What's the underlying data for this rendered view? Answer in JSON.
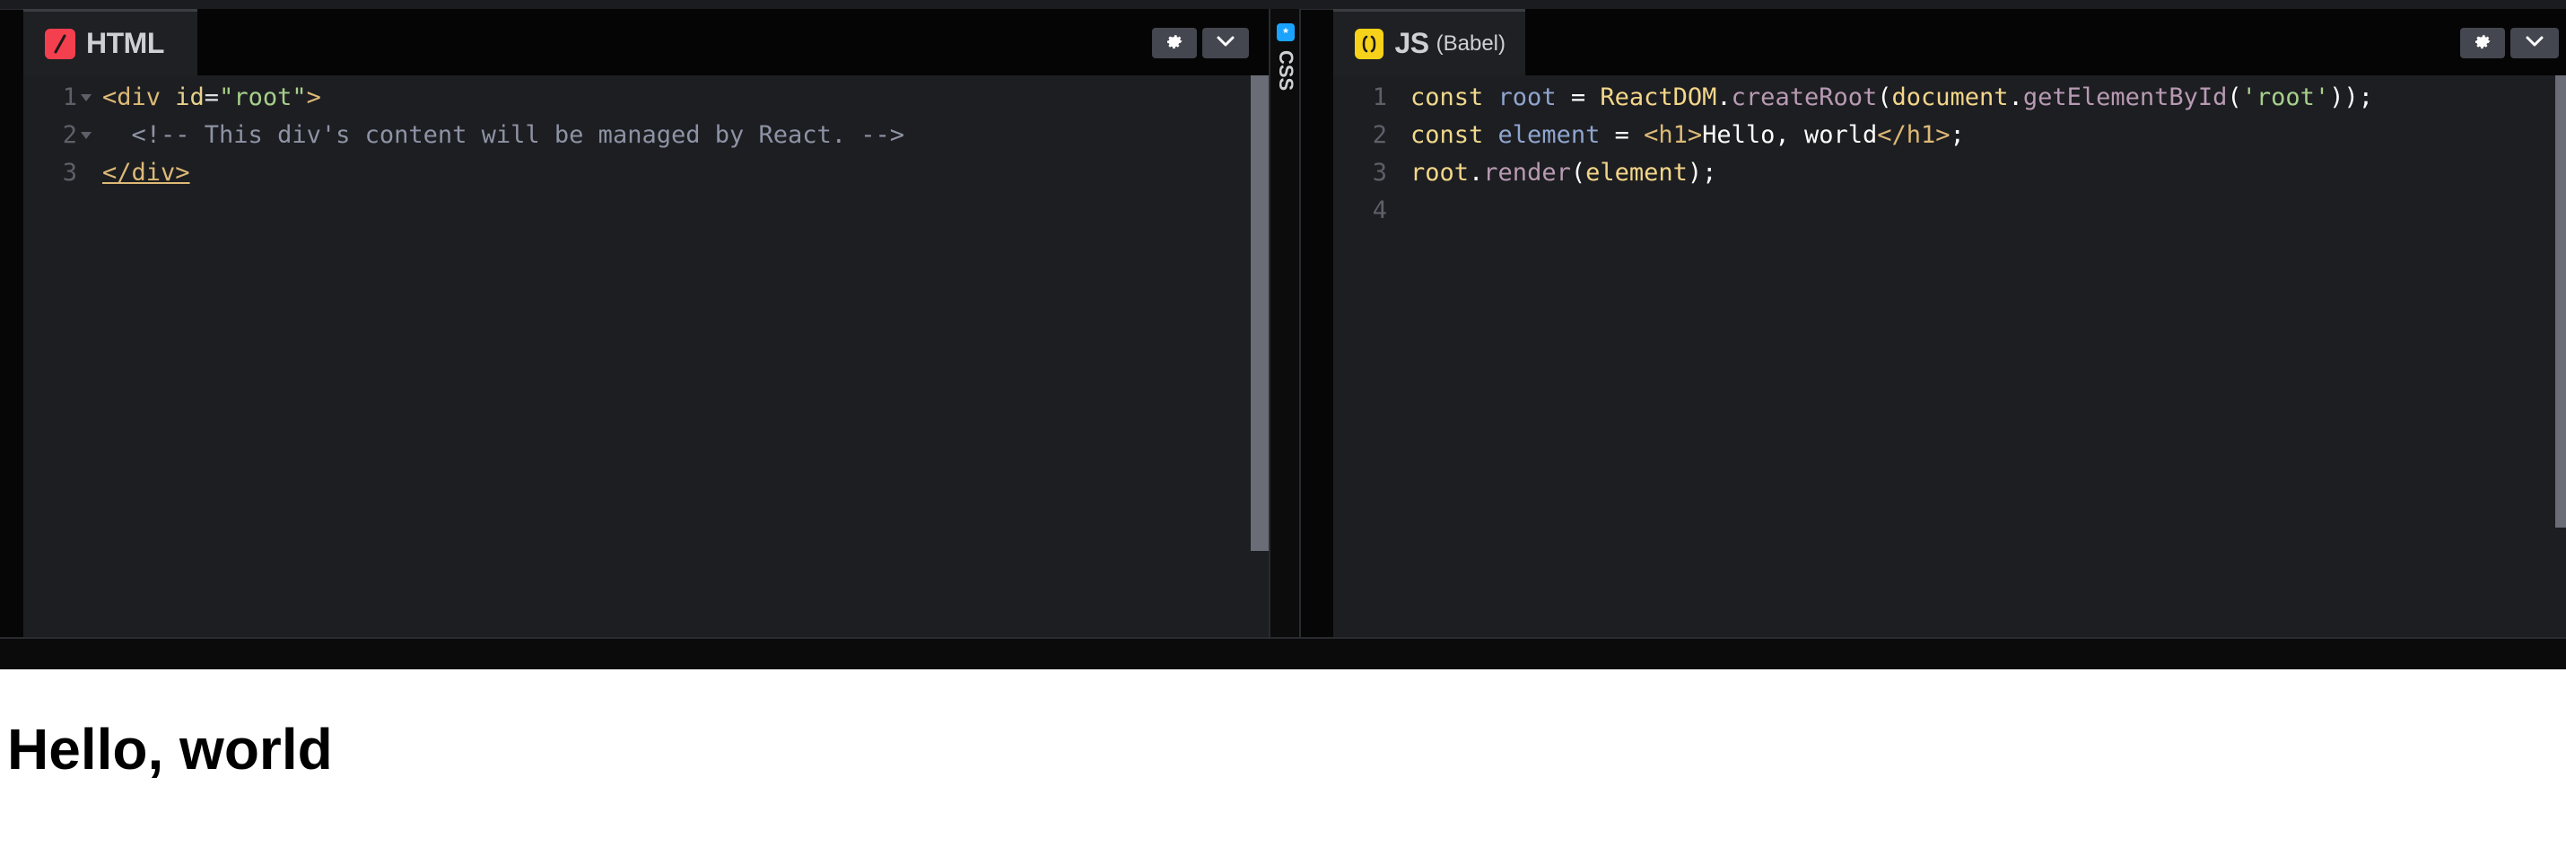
{
  "html_panel": {
    "title": "HTML",
    "icon": "slash-icon",
    "accent": "#f43f4f",
    "lines": [
      {
        "num": "1",
        "fold": true
      },
      {
        "num": "2",
        "fold": true
      },
      {
        "num": "3",
        "fold": false
      }
    ],
    "code": {
      "l1_open": "<div ",
      "l1_attr": "id",
      "l1_eq": "=",
      "l1_val": "\"root\"",
      "l1_close": ">",
      "l2_comment": "  <!-- This div's content will be managed by React. -->",
      "l3_close": "</div>"
    }
  },
  "css_panel": {
    "title": "CSS",
    "icon": "asterisk-icon",
    "accent": "#1aa4ff"
  },
  "js_panel": {
    "title": "JS",
    "subtitle": "(Babel)",
    "icon": "braces-icon",
    "accent": "#f7d21b",
    "lines": [
      "1",
      "2",
      "3",
      "4"
    ],
    "code": {
      "l1": {
        "kw": "const ",
        "var": "root",
        "op": " = ",
        "obj": "ReactDOM",
        "dot": ".",
        "fn": "createRoot",
        "p1": "(",
        "obj2": "document",
        "dot2": ".",
        "fn2": "getElementById",
        "p2": "(",
        "str": "'root'",
        "end": "));"
      },
      "l2": {
        "kw": "const ",
        "var": "element",
        "op": " = ",
        "tag_open": "<h1>",
        "text": "Hello, world",
        "tag_close": "</h1>",
        "end": ";"
      },
      "l3": {
        "obj": "root",
        "dot": ".",
        "fn": "render",
        "p1": "(",
        "arg": "element",
        "end": ");"
      }
    }
  },
  "preview": {
    "heading": "Hello, world"
  }
}
